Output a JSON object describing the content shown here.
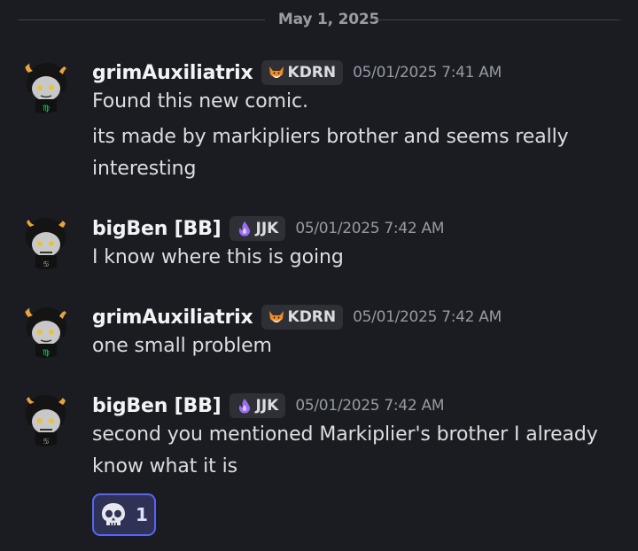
{
  "date_divider": "May 1, 2025",
  "messages": [
    {
      "username": "grimAuxiliatrix",
      "tag_icon": "fox-icon",
      "tag": "KDRN",
      "timestamp": "05/01/2025 7:41 AM",
      "lines": [
        "Found this new comic.",
        "its made by markipliers brother and seems really interesting"
      ]
    },
    {
      "username": "bigBen [BB]",
      "tag_icon": "purple-flame-icon",
      "tag": "JJK",
      "timestamp": "05/01/2025 7:42 AM",
      "lines": [
        "I know where this is going"
      ]
    },
    {
      "username": "grimAuxiliatrix",
      "tag_icon": "fox-icon",
      "tag": "KDRN",
      "timestamp": "05/01/2025 7:42 AM",
      "lines": [
        "one small problem"
      ]
    },
    {
      "username": "bigBen [BB]",
      "tag_icon": "purple-flame-icon",
      "tag": "JJK",
      "timestamp": "05/01/2025 7:42 AM",
      "lines": [
        "second you mentioned Markiplier's brother I already know what it is"
      ]
    }
  ],
  "reaction": {
    "emoji": "skull-icon",
    "count": "1"
  },
  "colors": {
    "background": "#1b1c21",
    "accent": "#5865f2",
    "reaction_bg": "#303255"
  }
}
